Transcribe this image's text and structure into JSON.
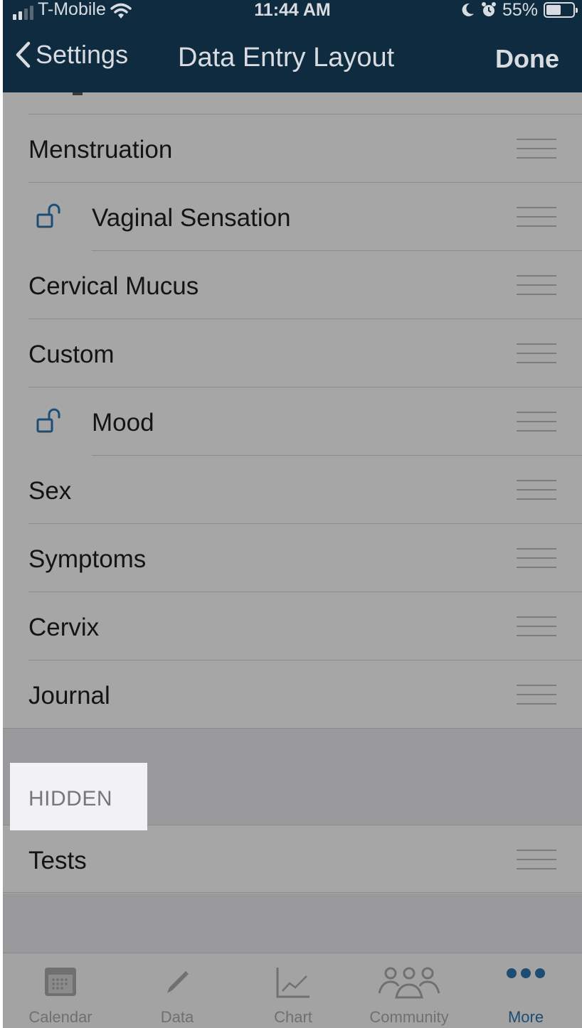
{
  "status_bar": {
    "carrier": "T-Mobile",
    "time": "11:44 AM",
    "battery": "55%",
    "battery_level": 0.55
  },
  "nav": {
    "back_label": "Settings",
    "title": "Data Entry Layout",
    "done_label": "Done"
  },
  "visible_items": [
    {
      "label": "Menstruation",
      "locked": false
    },
    {
      "label": "Vaginal Sensation",
      "locked": true
    },
    {
      "label": "Cervical Mucus",
      "locked": false
    },
    {
      "label": "Custom",
      "locked": false
    },
    {
      "label": "Mood",
      "locked": true
    },
    {
      "label": "Sex",
      "locked": false
    },
    {
      "label": "Symptoms",
      "locked": false
    },
    {
      "label": "Cervix",
      "locked": false
    },
    {
      "label": "Journal",
      "locked": false
    }
  ],
  "hidden_section": {
    "header": "HIDDEN",
    "items": [
      {
        "label": "Tests"
      }
    ]
  },
  "tab_bar": {
    "tabs": [
      {
        "label": "Calendar",
        "icon": "calendar-icon"
      },
      {
        "label": "Data",
        "icon": "pencil-icon"
      },
      {
        "label": "Chart",
        "icon": "chart-icon"
      },
      {
        "label": "Community",
        "icon": "people-icon"
      },
      {
        "label": "More",
        "icon": "more-icon"
      }
    ],
    "active_tab": "More"
  },
  "colors": {
    "nav_background": "#0f2b40",
    "accent": "#1d4d73",
    "overlay_gray": "#a6a6a6"
  }
}
